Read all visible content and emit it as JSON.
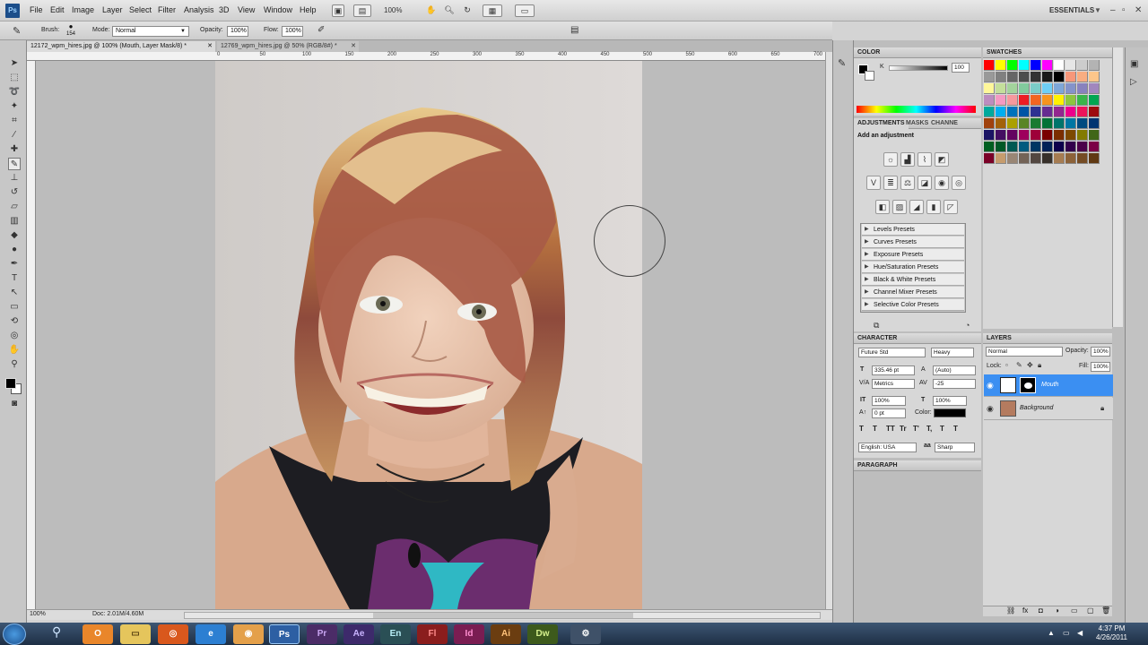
{
  "menu": {
    "app_icon": "Ps",
    "items": [
      "File",
      "Edit",
      "Image",
      "Layer",
      "Select",
      "Filter",
      "Analysis",
      "3D",
      "View",
      "Window",
      "Help"
    ],
    "zoom": "100%",
    "workspace": "ESSENTIALS"
  },
  "options_bar": {
    "brush_label": "Brush:",
    "brush_size": "154",
    "mode_label": "Mode:",
    "mode_value": "Normal",
    "opacity_label": "Opacity:",
    "opacity_value": "100%",
    "flow_label": "Flow:",
    "flow_value": "100%"
  },
  "tabs": [
    {
      "label": "12172_wpm_hires.jpg @ 100% (Mouth, Layer Mask/8) *",
      "active": true
    },
    {
      "label": "12769_wpm_hires.jpg @ 50% (RGB/8#) *",
      "active": false
    }
  ],
  "ruler": {
    "top_numbers": [
      "0",
      "50",
      "100",
      "150",
      "200",
      "250",
      "300",
      "350",
      "400",
      "450",
      "500",
      "550",
      "600",
      "650",
      "700",
      "750",
      "800",
      "850"
    ]
  },
  "status": {
    "zoom": "100%",
    "doc": "Doc: 2.01M/4.60M"
  },
  "color_panel": {
    "title": "COLOR",
    "channel": "K",
    "value": "100"
  },
  "swatches_panel": {
    "title": "SWATCHES"
  },
  "adjustments_panel": {
    "tabs": [
      "ADJUSTMENTS",
      "MASKS",
      "CHANNE"
    ],
    "heading": "Add an adjustment",
    "presets": [
      "Levels Presets",
      "Curves Presets",
      "Exposure Presets",
      "Hue/Saturation Presets",
      "Black & White Presets",
      "Channel Mixer Presets",
      "Selective Color Presets"
    ]
  },
  "character_panel": {
    "title": "CHARACTER",
    "font_family": "Future Std",
    "font_style": "Heavy",
    "size": "335.46 pt",
    "leading": "(Auto)",
    "kerning": "Metrics",
    "tracking": "-25",
    "vscale": "100%",
    "hscale": "100%",
    "baseline": "0 pt",
    "color_label": "Color:",
    "type_buttons": [
      "T",
      "T",
      "TT",
      "Tr",
      "T'",
      "T,",
      "T",
      "T"
    ],
    "language": "English: USA",
    "aa_label": "aa",
    "antialias": "Sharp"
  },
  "paragraph_panel": {
    "title": "PARAGRAPH"
  },
  "layers_panel": {
    "title": "LAYERS",
    "blend_mode": "Normal",
    "opacity_label": "Opacity:",
    "opacity_value": "100%",
    "lock_label": "Lock:",
    "fill_label": "Fill:",
    "fill_value": "100%",
    "layers": [
      {
        "name": "Mouth",
        "selected": true
      },
      {
        "name": "Background",
        "selected": false
      }
    ]
  },
  "taskbar": {
    "apps": [
      "Pr",
      "Ae",
      "En",
      "Fl",
      "Id",
      "Ai",
      "Dw"
    ],
    "ps_label": "Ps",
    "time": "4:37 PM",
    "date": "4/26/2011"
  },
  "colors": {
    "selected_layer": "#3b8ff2",
    "swatch_grid": [
      "#ff0000",
      "#ffff00",
      "#00ff00",
      "#00ffff",
      "#0000ff",
      "#ff00ff",
      "#ffffff",
      "#e6e6e6",
      "#cccccc",
      "#b3b3b3",
      "#999999",
      "#808080",
      "#666666",
      "#4d4d4d",
      "#333333",
      "#1a1a1a",
      "#000000",
      "#f7977a",
      "#f9ad81",
      "#fdc68a",
      "#fff79a",
      "#c4df9b",
      "#a3d39c",
      "#82ca9d",
      "#7bcdc8",
      "#6ecff6",
      "#7ea7d8",
      "#8493ca",
      "#8882be",
      "#a187be",
      "#bc8dbf",
      "#f49ac2",
      "#f6989d",
      "#ed1c24",
      "#f26522",
      "#f7941d",
      "#fff200",
      "#8dc63f",
      "#39b54a",
      "#00a651",
      "#00a99d",
      "#00aeef",
      "#0072bc",
      "#0054a6",
      "#2e3192",
      "#662d91",
      "#92278f",
      "#ec008c",
      "#ed145b",
      "#9e0b0f",
      "#a0410d",
      "#a36209",
      "#aba000",
      "#598527",
      "#197b30",
      "#007236",
      "#00746b",
      "#0076a3",
      "#004a80",
      "#003471",
      "#1b1464",
      "#440e62",
      "#630460",
      "#9e005d",
      "#9e0039",
      "#790000",
      "#7b2e00",
      "#7d4900",
      "#827b00",
      "#406618",
      "#005e20",
      "#005826",
      "#005952",
      "#005b7f",
      "#003663",
      "#002157",
      "#0d004c",
      "#32004b",
      "#4b0049",
      "#7b0046",
      "#7a0026",
      "#c69c6d",
      "#998675",
      "#736357",
      "#534741",
      "#37302a",
      "#a67c52",
      "#8c6239",
      "#754c24",
      "#603913"
    ]
  }
}
